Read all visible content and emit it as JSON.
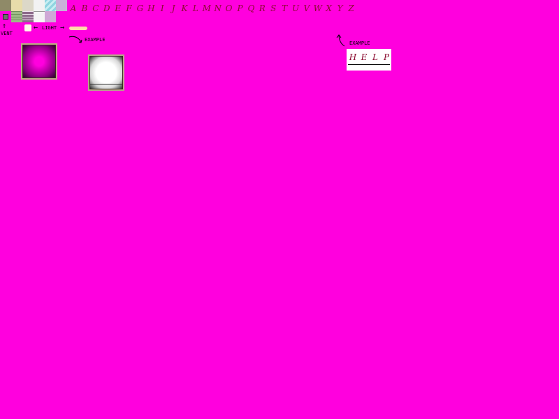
{
  "labels": {
    "vent": "VENT",
    "light": "LIGHT",
    "example_left": "EXAMPLE",
    "example_right": "EXAMPLE"
  },
  "alphabet": [
    "A",
    "B",
    "C",
    "D",
    "E",
    "F",
    "G",
    "H",
    "I",
    "J",
    "K",
    "L",
    "M",
    "N",
    "O",
    "P",
    "Q",
    "R",
    "S",
    "T",
    "U",
    "V",
    "W",
    "X",
    "Y",
    "Z"
  ],
  "sign": {
    "letters": [
      "H",
      "E",
      "L",
      "P"
    ]
  },
  "colors": {
    "background": "#ff00de",
    "letter": "#8a0a2f",
    "light_bar": "#ffd9a8",
    "panel_white": "#ffffff",
    "panel_frame": "#000000"
  },
  "icons": {
    "vent": "vent-icon",
    "light": "light-bulb-icon",
    "arrow_up": "arrow-up-icon",
    "arrow_left": "arrow-left-icon",
    "arrow_right": "arrow-right-icon",
    "arrow_curve": "curved-arrow-icon"
  }
}
